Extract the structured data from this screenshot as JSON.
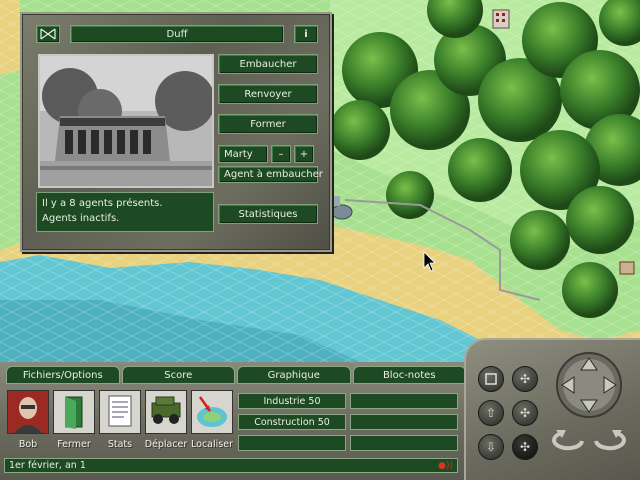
{
  "staff_window": {
    "title": "Duff",
    "close_icon": "close-icon",
    "info_label": "i",
    "buttons": {
      "hire": "Embaucher",
      "fire": "Renvoyer",
      "train": "Former",
      "stats": "Statistiques"
    },
    "agent_name": "Marty",
    "decrement_label": "–",
    "increment_label": "+",
    "agent_to_hire": "Agent à embaucher",
    "status_line_1": "Il y a 8 agents présents.",
    "status_line_2": "Agents inactifs."
  },
  "menu": {
    "items": [
      "Fichiers/Options",
      "Score",
      "Graphique",
      "Bloc-notes"
    ]
  },
  "tools": [
    {
      "label": "Bob",
      "icon": "advisor-portrait-icon"
    },
    {
      "label": "Fermer",
      "icon": "exit-door-icon"
    },
    {
      "label": "Stats",
      "icon": "document-icon"
    },
    {
      "label": "Déplacer",
      "icon": "jeep-icon"
    },
    {
      "label": "Localiser",
      "icon": "locate-map-icon"
    }
  ],
  "info_fields": {
    "industry": "Industrie 50",
    "construction": "Construction 50"
  },
  "status_bar": {
    "date": "1er février, an 1"
  },
  "colors": {
    "panel_green": "#1d4a23",
    "panel_text": "#e8f0e0",
    "water": "#5fc3d0",
    "sand": "#e6cf7a",
    "grass": "#9fdc8a",
    "forest": "#2f6e2a"
  },
  "navigation": {
    "icons": [
      "rotate-square-icon",
      "zoom-in-icon",
      "move-up-icon",
      "zoom-button-icon",
      "move-down-icon",
      "zoom-active-icon",
      "compass-arrows-icon",
      "rotate-left-icon",
      "rotate-right-icon"
    ]
  }
}
